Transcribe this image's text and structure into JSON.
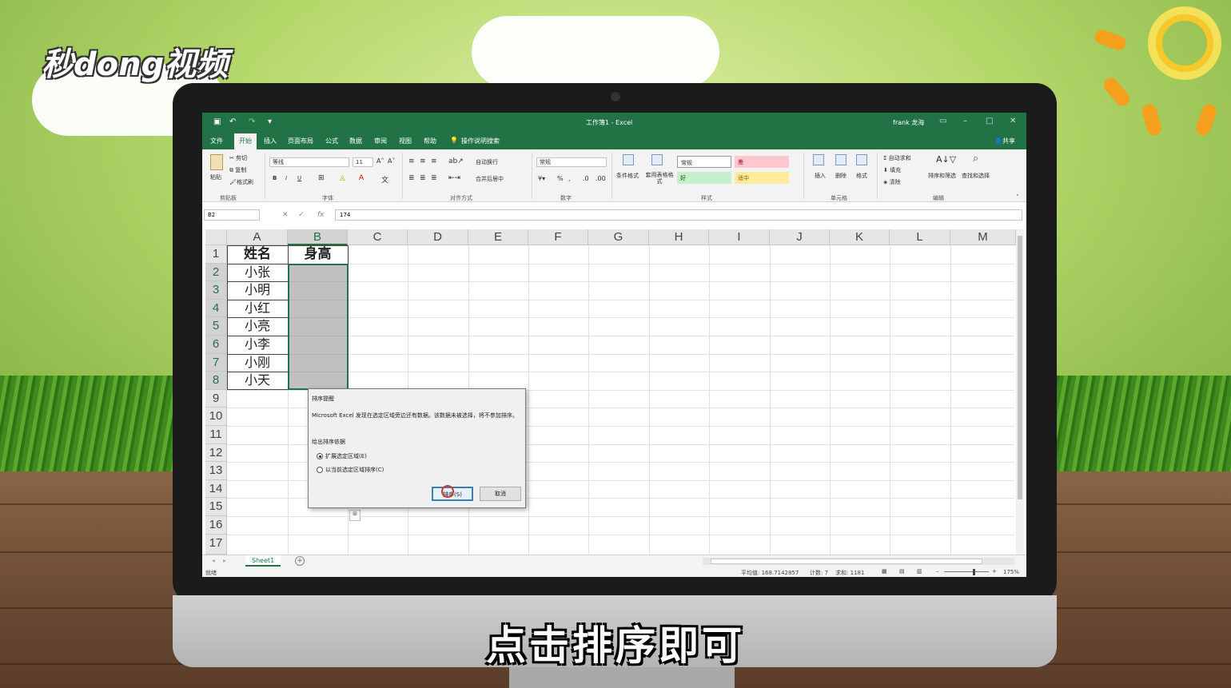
{
  "brand": {
    "logo_text": "秒dong视频"
  },
  "subtitle": "点击排序即可",
  "excel": {
    "title": "工作簿1 - Excel",
    "user": "frank 龙海",
    "share": "共享",
    "tabs": [
      "文件",
      "开始",
      "插入",
      "页面布局",
      "公式",
      "数据",
      "审阅",
      "视图",
      "帮助"
    ],
    "active_tab": "开始",
    "tell_me": "操作说明搜索",
    "ribbon": {
      "clipboard": {
        "label": "剪贴板",
        "paste": "粘贴",
        "cut": "剪切",
        "copy": "复制",
        "format_painter": "格式刷"
      },
      "font": {
        "label": "字体",
        "font_name": "等线",
        "font_size": "11"
      },
      "alignment": {
        "label": "对齐方式",
        "wrap": "自动换行",
        "merge": "合并后居中"
      },
      "number": {
        "label": "数字",
        "format": "常规"
      },
      "styles": {
        "label": "样式",
        "conditional": "条件格式",
        "table": "套用表格格式",
        "normal": "常规",
        "bad": "差",
        "good": "好",
        "neutral": "适中"
      },
      "cells": {
        "label": "单元格",
        "insert": "插入",
        "delete": "删除",
        "format": "格式"
      },
      "editing": {
        "label": "编辑",
        "autosum": "自动求和",
        "fill": "填充",
        "clear": "清除",
        "sort_filter": "排序和筛选",
        "find": "查找和选择"
      }
    },
    "name_box": "B2",
    "formula_value": "174",
    "columns": [
      "A",
      "B",
      "C",
      "D",
      "E",
      "F",
      "G",
      "H",
      "I",
      "J",
      "K",
      "L",
      "M"
    ],
    "rows": [
      "1",
      "2",
      "3",
      "4",
      "5",
      "6",
      "7",
      "8",
      "9",
      "10",
      "11",
      "12",
      "13",
      "14",
      "15",
      "16",
      "17"
    ],
    "table": {
      "header_a": "姓名",
      "header_b": "身高",
      "names": [
        "小张",
        "小明",
        "小红",
        "小亮",
        "小李",
        "小刚",
        "小天"
      ]
    },
    "sheet_tab": "Sheet1",
    "status": {
      "ready": "就绪",
      "average": "平均值: 168.7142857",
      "count": "计数: 7",
      "sum": "求和: 1181",
      "zoom": "175%"
    },
    "dialog": {
      "title": "排序提醒",
      "message": "Microsoft Excel 发现在选定区域旁边还有数据。该数据未被选择，将不参加排序。",
      "group_label": "给出排序依据",
      "option_expand": "扩展选定区域(E)",
      "option_current": "以当前选定区域排序(C)",
      "sort_button": "排序(S)",
      "cancel_button": "取消"
    }
  }
}
